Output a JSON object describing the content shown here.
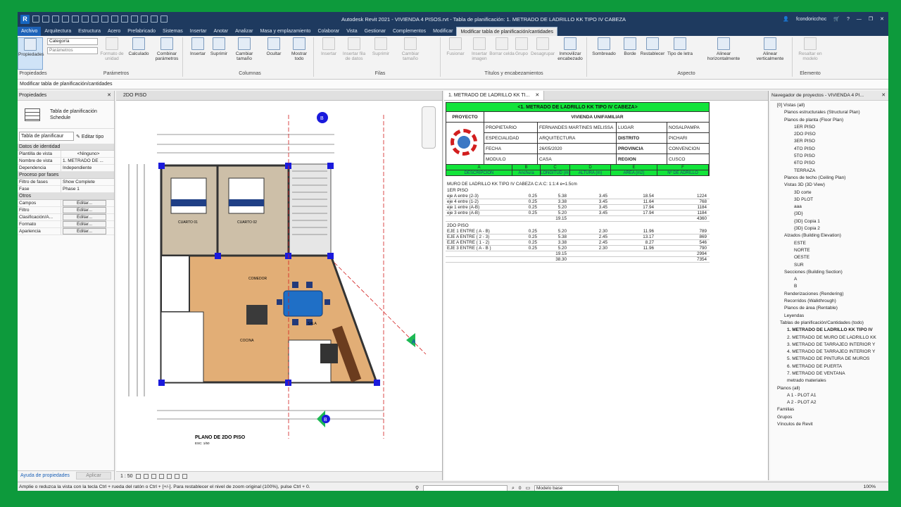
{
  "window": {
    "title": "Autodesk Revit 2021 - VIVIENDA 4 PISOS.rvt - Tabla de planificación: 1. METRADO DE LADRILLO KK TIPO IV CABEZA",
    "user": "fcondoricchoc"
  },
  "tabs": [
    "Archivo",
    "Arquitectura",
    "Estructura",
    "Acero",
    "Prefabricado",
    "Sistemas",
    "Insertar",
    "Anotar",
    "Analizar",
    "Masa y emplazamiento",
    "Colaborar",
    "Vista",
    "Gestionar",
    "Complementos",
    "Modificar",
    "Modificar tabla de planificación/cantidades"
  ],
  "ribbon": {
    "buttons": [
      "Propiedades",
      "Formato de unidad",
      "Calculado",
      "Combinar parámetros",
      "Insertar",
      "Suprimir",
      "Cambiar tamaño",
      "Ocultar",
      "Mostrar todo",
      "Insertar",
      "Insertar fila de datos",
      "Suprimir",
      "Cambiar tamaño",
      "Fusionar",
      "Insertar imagen",
      "Borrar celda",
      "Grupo",
      "Desagrupar",
      "Inmovilizar encabezado",
      "Sombreado",
      "Borde",
      "Restablecer",
      "Tipo de letra",
      "Alinear horizontalmente",
      "Alinear verticalmente",
      "Resaltar en modelo"
    ],
    "category_label": "Categoría",
    "param_label": "Parámetros",
    "panels": [
      "Propiedades",
      "Parámetros",
      "Columnas",
      "Filas",
      "Títulos y encabezamientos",
      "Aspecto",
      "Elemento"
    ]
  },
  "status_top": "Modificar tabla de planificación/cantidades",
  "properties": {
    "header": "Propiedades",
    "type_name": "Tabla de planificación",
    "type_sub": "Schedule",
    "selector": "Tabla de planificaur",
    "edit_type": "Editar tipo",
    "section_identity": "Datos de identidad",
    "rows_identity": [
      [
        "Plantilla de vista",
        "<Ninguno>"
      ],
      [
        "Nombre de vista",
        "1. METRADO DE ..."
      ],
      [
        "Dependencia",
        "Independiente"
      ]
    ],
    "section_phase": "Proceso por fases",
    "rows_phase": [
      [
        "Filtro de fases",
        "Show Complete"
      ],
      [
        "Fase",
        "Phase 1"
      ]
    ],
    "section_other": "Otros",
    "rows_other": [
      [
        "Campos",
        "Editar..."
      ],
      [
        "Filtro",
        "Editar..."
      ],
      [
        "Clasificación/A...",
        "Editar..."
      ],
      [
        "Formato",
        "Editar..."
      ],
      [
        "Apariencia",
        "Editar..."
      ]
    ],
    "help": "Ayuda de propiedades",
    "apply": "Aplicar"
  },
  "view1": {
    "tab": "2DO PISO",
    "scale": "1 : 50",
    "plan_title": "PLANO DE 2DO PISO",
    "plan_scale": "ESC: 1/50",
    "rooms": [
      {
        "name": "CUARTO 01"
      },
      {
        "name": "CUARTO 02"
      },
      {
        "name": "COMEDOR"
      },
      {
        "name": "SALA"
      },
      {
        "name": "COCINA"
      }
    ],
    "markers": {
      "b_top": "B",
      "b_bottom": "B",
      "a_right": "A"
    }
  },
  "schedule": {
    "tab": "1. METRADO DE LADRILLO KK TI...",
    "title": "<1. METRADO DE LADRILLO KK TIPO IV CABEZA>",
    "proyecto_label": "PROYECTO",
    "proyecto": "VIVIENDA UNIFAMILIAR",
    "info": [
      [
        "PROPIETARIO",
        "FERNANDES MARTINES MELISSA",
        "LUGAR",
        "NOSALPAMPA"
      ],
      [
        "ESPECIALIDAD",
        "ARQUITECTURA",
        "DISTRITO",
        "PICHARI"
      ],
      [
        "FECHA",
        "26/05/2020",
        "PROVINCIA",
        "CONVENCION"
      ],
      [
        "MODULO",
        "CASA",
        "REGION",
        "CUSCO"
      ]
    ],
    "letters": [
      "A",
      "B",
      "C",
      "D",
      "E",
      "F"
    ],
    "columns": [
      "DESCRIPCION",
      "Anchura",
      "LONGITUD (m)",
      "ALTURA (m)",
      "AREA (m2)",
      "Nº DE ADRILLO"
    ],
    "subtitle": "MURO DE LADRILLO KK TIPO IV CABEZA C:A:C: 1:1:4 e=1.5cm",
    "groups": [
      {
        "name": "1ER PISO",
        "rows": [
          [
            "eje A entre (2-3)",
            "0.25",
            "5.38",
            "3.45",
            "18.54",
            "1224"
          ],
          [
            "eje 4 entre (1-2)",
            "0.25",
            "3.38",
            "3.45",
            "11.64",
            "768"
          ],
          [
            "eje 1 entre (A-B)",
            "0.25",
            "5.20",
            "3.45",
            "17.94",
            "1184"
          ],
          [
            "eje 3 entre (A-B)",
            "0.25",
            "5.20",
            "3.45",
            "17.94",
            "1184"
          ]
        ],
        "sub": [
          "",
          "",
          "19.15",
          "",
          "",
          "4360"
        ]
      },
      {
        "name": "2DO PISO",
        "rows": [
          [
            "EJE 1 ENTRE ( A - B)",
            "0.25",
            "5.20",
            "2.30",
            "11.96",
            "789"
          ],
          [
            "EJE A ENTRE ( 2 - 3)",
            "0.25",
            "5.38",
            "2.45",
            "13.17",
            "869"
          ],
          [
            "EJE A ENTRE ( 1 - 2)",
            "0.25",
            "3.38",
            "2.45",
            "8.27",
            "546"
          ],
          [
            "EJE 3 ENTRE ( A - B )",
            "0.25",
            "5.20",
            "2.30",
            "11.96",
            "790"
          ]
        ],
        "sub": [
          "",
          "",
          "19.15",
          "",
          "",
          "2994"
        ]
      }
    ],
    "total": [
      "",
      "",
      "38.30",
      "",
      "",
      "7354"
    ]
  },
  "navigator": {
    "header": "Navegador de proyectos - VIVIENDA 4 PI...",
    "items": [
      "[0] Vistas (all)",
      "Planos estructurales (Structural Plan)",
      "Planos de planta (Floor Plan)",
      "1ER PISO",
      "2DO PISO",
      "3ER PISO",
      "4TO PISO",
      "5TO PISO",
      "6TO PISO",
      "TERRAZA",
      "Planos de techo (Ceiling Plan)",
      "Vistas 3D (3D View)",
      "3D corte",
      "3D PLOT",
      "aaa",
      "{3D}",
      "{3D} Copia 1",
      "{3D} Copia 2",
      "Alzados (Building Elevation)",
      "ESTE",
      "NORTE",
      "OESTE",
      "SUR",
      "Secciones (Building Section)",
      "A",
      "B",
      "Renderizaciones (Rendering)",
      "Recorridos (Walkthrough)",
      "Planos de área (Rentable)",
      "Leyendas",
      "Tablas de planificación/Cantidades (todo)",
      "1. METRADO DE LADRILLO KK TIPO IV",
      "2. METRADO DE MURO DE LADRILLO KK",
      "3. METRADO DE TARRAJEO INTERIOR Y",
      "4. METRADO DE TARRAJEO INTERIOR Y",
      "5. METRADO DE PINTURA DE MUROS",
      "6. METRADO DE PUERTA",
      "7. METRADO DE VENTANA",
      "metrado materiales",
      "Planos (all)",
      "A 1 - PLOT A1",
      "A 2 - PLOT A2",
      "Familias",
      "Grupos",
      "Vínculos de Revit"
    ]
  },
  "statusbar": {
    "text": "Amplie o reduzca la vista con la tecla Ctrl + rueda del ratón o Ctrl + [+/-]. Para restablecer el nivel de zoom original (100%), pulse Ctrl + 0.",
    "model": "Modelo base",
    "zoom_value": "0",
    "zoom": "100%"
  },
  "colors": {
    "header_green": "#12e43a",
    "title_bar": "#1e3a5f",
    "border_green": "#0d9a3c"
  }
}
